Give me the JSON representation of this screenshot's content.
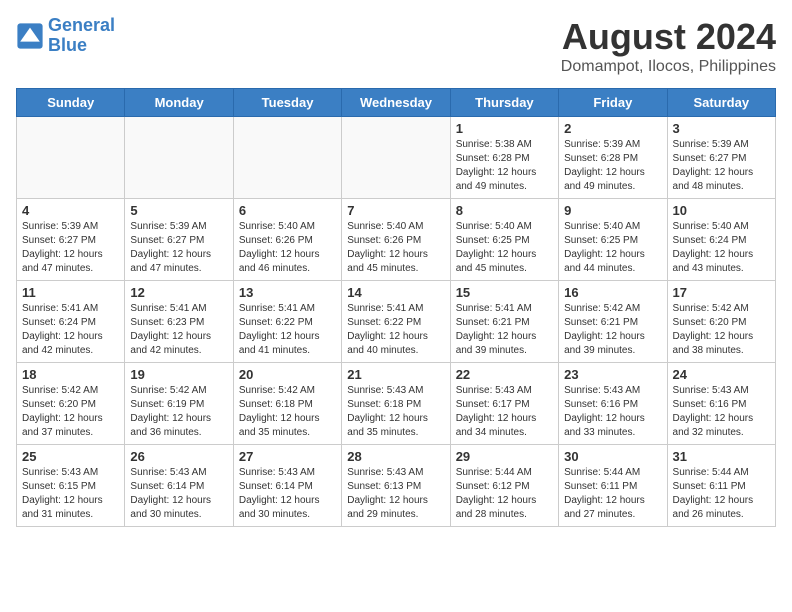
{
  "logo": {
    "line1": "General",
    "line2": "Blue"
  },
  "title": "August 2024",
  "subtitle": "Domampot, Ilocos, Philippines",
  "headers": [
    "Sunday",
    "Monday",
    "Tuesday",
    "Wednesday",
    "Thursday",
    "Friday",
    "Saturday"
  ],
  "weeks": [
    [
      {
        "day": "",
        "info": ""
      },
      {
        "day": "",
        "info": ""
      },
      {
        "day": "",
        "info": ""
      },
      {
        "day": "",
        "info": ""
      },
      {
        "day": "1",
        "info": "Sunrise: 5:38 AM\nSunset: 6:28 PM\nDaylight: 12 hours\nand 49 minutes."
      },
      {
        "day": "2",
        "info": "Sunrise: 5:39 AM\nSunset: 6:28 PM\nDaylight: 12 hours\nand 49 minutes."
      },
      {
        "day": "3",
        "info": "Sunrise: 5:39 AM\nSunset: 6:27 PM\nDaylight: 12 hours\nand 48 minutes."
      }
    ],
    [
      {
        "day": "4",
        "info": "Sunrise: 5:39 AM\nSunset: 6:27 PM\nDaylight: 12 hours\nand 47 minutes."
      },
      {
        "day": "5",
        "info": "Sunrise: 5:39 AM\nSunset: 6:27 PM\nDaylight: 12 hours\nand 47 minutes."
      },
      {
        "day": "6",
        "info": "Sunrise: 5:40 AM\nSunset: 6:26 PM\nDaylight: 12 hours\nand 46 minutes."
      },
      {
        "day": "7",
        "info": "Sunrise: 5:40 AM\nSunset: 6:26 PM\nDaylight: 12 hours\nand 45 minutes."
      },
      {
        "day": "8",
        "info": "Sunrise: 5:40 AM\nSunset: 6:25 PM\nDaylight: 12 hours\nand 45 minutes."
      },
      {
        "day": "9",
        "info": "Sunrise: 5:40 AM\nSunset: 6:25 PM\nDaylight: 12 hours\nand 44 minutes."
      },
      {
        "day": "10",
        "info": "Sunrise: 5:40 AM\nSunset: 6:24 PM\nDaylight: 12 hours\nand 43 minutes."
      }
    ],
    [
      {
        "day": "11",
        "info": "Sunrise: 5:41 AM\nSunset: 6:24 PM\nDaylight: 12 hours\nand 42 minutes."
      },
      {
        "day": "12",
        "info": "Sunrise: 5:41 AM\nSunset: 6:23 PM\nDaylight: 12 hours\nand 42 minutes."
      },
      {
        "day": "13",
        "info": "Sunrise: 5:41 AM\nSunset: 6:22 PM\nDaylight: 12 hours\nand 41 minutes."
      },
      {
        "day": "14",
        "info": "Sunrise: 5:41 AM\nSunset: 6:22 PM\nDaylight: 12 hours\nand 40 minutes."
      },
      {
        "day": "15",
        "info": "Sunrise: 5:41 AM\nSunset: 6:21 PM\nDaylight: 12 hours\nand 39 minutes."
      },
      {
        "day": "16",
        "info": "Sunrise: 5:42 AM\nSunset: 6:21 PM\nDaylight: 12 hours\nand 39 minutes."
      },
      {
        "day": "17",
        "info": "Sunrise: 5:42 AM\nSunset: 6:20 PM\nDaylight: 12 hours\nand 38 minutes."
      }
    ],
    [
      {
        "day": "18",
        "info": "Sunrise: 5:42 AM\nSunset: 6:20 PM\nDaylight: 12 hours\nand 37 minutes."
      },
      {
        "day": "19",
        "info": "Sunrise: 5:42 AM\nSunset: 6:19 PM\nDaylight: 12 hours\nand 36 minutes."
      },
      {
        "day": "20",
        "info": "Sunrise: 5:42 AM\nSunset: 6:18 PM\nDaylight: 12 hours\nand 35 minutes."
      },
      {
        "day": "21",
        "info": "Sunrise: 5:43 AM\nSunset: 6:18 PM\nDaylight: 12 hours\nand 35 minutes."
      },
      {
        "day": "22",
        "info": "Sunrise: 5:43 AM\nSunset: 6:17 PM\nDaylight: 12 hours\nand 34 minutes."
      },
      {
        "day": "23",
        "info": "Sunrise: 5:43 AM\nSunset: 6:16 PM\nDaylight: 12 hours\nand 33 minutes."
      },
      {
        "day": "24",
        "info": "Sunrise: 5:43 AM\nSunset: 6:16 PM\nDaylight: 12 hours\nand 32 minutes."
      }
    ],
    [
      {
        "day": "25",
        "info": "Sunrise: 5:43 AM\nSunset: 6:15 PM\nDaylight: 12 hours\nand 31 minutes."
      },
      {
        "day": "26",
        "info": "Sunrise: 5:43 AM\nSunset: 6:14 PM\nDaylight: 12 hours\nand 30 minutes."
      },
      {
        "day": "27",
        "info": "Sunrise: 5:43 AM\nSunset: 6:14 PM\nDaylight: 12 hours\nand 30 minutes."
      },
      {
        "day": "28",
        "info": "Sunrise: 5:43 AM\nSunset: 6:13 PM\nDaylight: 12 hours\nand 29 minutes."
      },
      {
        "day": "29",
        "info": "Sunrise: 5:44 AM\nSunset: 6:12 PM\nDaylight: 12 hours\nand 28 minutes."
      },
      {
        "day": "30",
        "info": "Sunrise: 5:44 AM\nSunset: 6:11 PM\nDaylight: 12 hours\nand 27 minutes."
      },
      {
        "day": "31",
        "info": "Sunrise: 5:44 AM\nSunset: 6:11 PM\nDaylight: 12 hours\nand 26 minutes."
      }
    ]
  ]
}
